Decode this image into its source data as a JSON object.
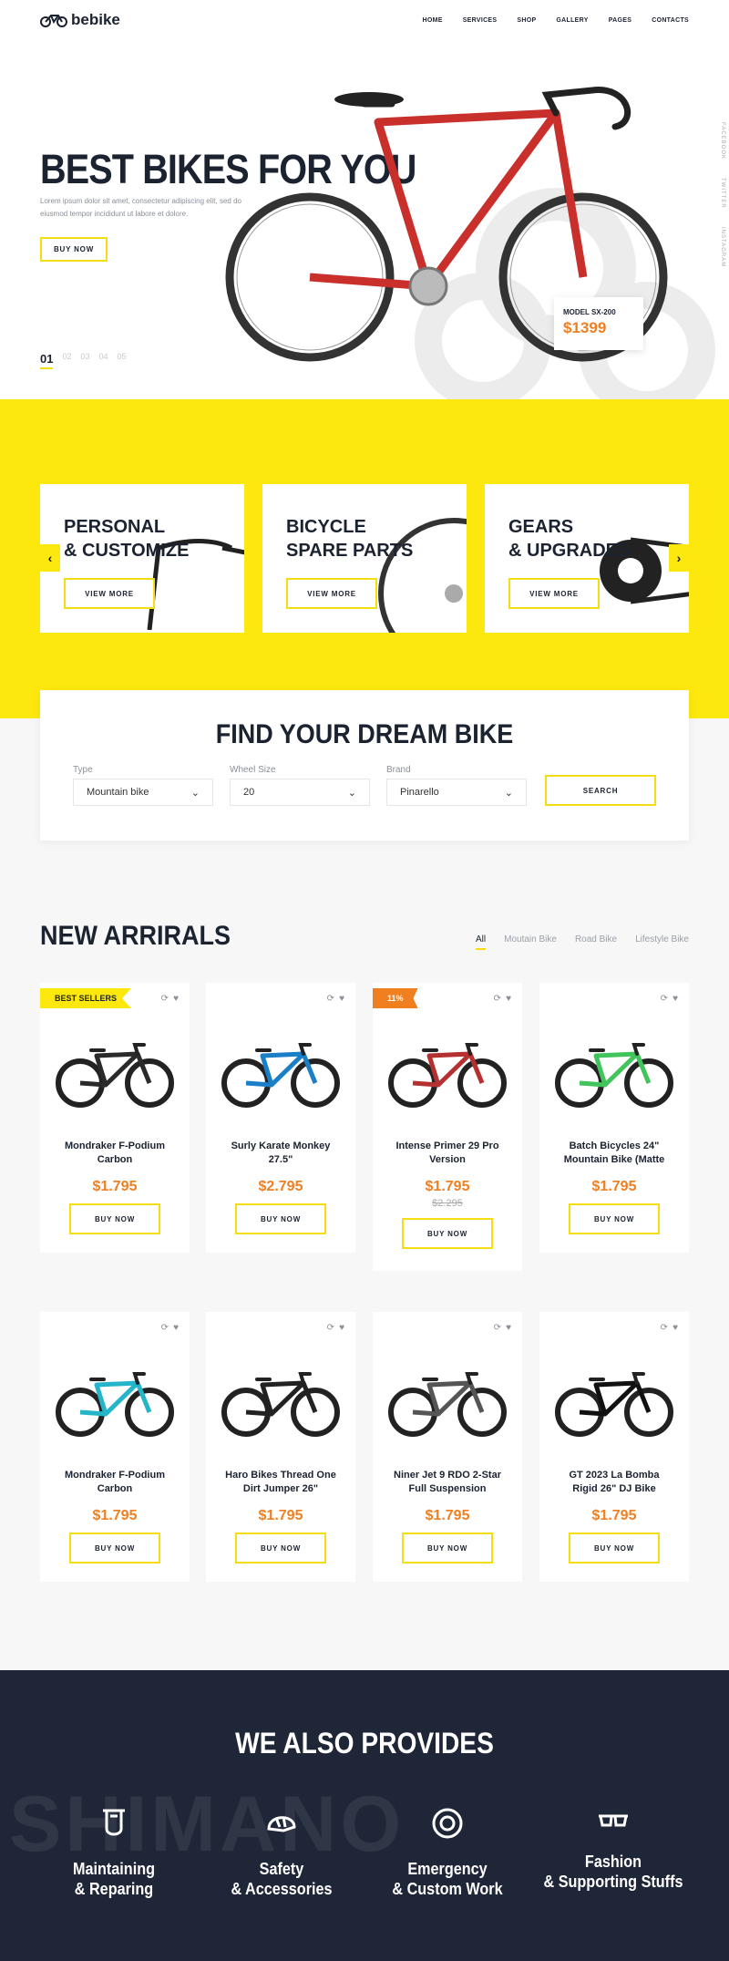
{
  "brand": {
    "name": "bebike"
  },
  "nav": [
    "HOME",
    "SERVICES",
    "SHOP",
    "GALLERY",
    "PAGES",
    "CONTACTS"
  ],
  "hero": {
    "title": "BEST BIKES FOR YOU",
    "desc": "Lorem ipsum dolor sit amet, consectetur adipiscing elit, sed do eiusmod tempor incididunt ut labore et dolore.",
    "button": "BUY NOW",
    "model": "MODEL SX-200",
    "price": "$1399",
    "slides": [
      "01",
      "02",
      "03",
      "04",
      "05"
    ],
    "social": [
      "FACEBOOK",
      "TWITTER",
      "INSTAGRAM"
    ]
  },
  "categories": [
    {
      "title_1": "PERSONAL",
      "title_2": "& CUSTOMIZE",
      "button": "VIEW MORE"
    },
    {
      "title_1": "BICYCLE",
      "title_2": "SPARE PARTS",
      "button": "VIEW MORE"
    },
    {
      "title_1": "GEARS",
      "title_2": "& UPGRADES",
      "button": "VIEW MORE"
    }
  ],
  "finder": {
    "title": "FIND YOUR DREAM BIKE",
    "type_label": "Type",
    "type_value": "Mountain bike",
    "wheel_label": "Wheel Size",
    "wheel_value": "20",
    "brand_label": "Brand",
    "brand_value": "Pinarello",
    "search": "SEARCH"
  },
  "arrivals": {
    "title": "NEW ARRIRALS",
    "tabs": [
      "All",
      "Moutain Bike",
      "Road Bike",
      "Lifestyle Bike"
    ]
  },
  "products": [
    {
      "badge": "BEST SELLERS",
      "name": "Mondraker F-Podium Carbon",
      "price": "$1.795",
      "old": "",
      "button": "BUY NOW",
      "color": "#2a2a2a"
    },
    {
      "badge": "",
      "name": "Surly Karate Monkey 27.5\"",
      "price": "$2.795",
      "old": "",
      "button": "BUY NOW",
      "color": "#1a7fc7"
    },
    {
      "badge": "11%",
      "name": "Intense Primer 29 Pro Version",
      "price": "$1.795",
      "old": "$2.295",
      "button": "BUY NOW",
      "color": "#b53030"
    },
    {
      "badge": "",
      "name": "Batch Bicycles 24\" Mountain Bike (Matte",
      "price": "$1.795",
      "old": "",
      "button": "BUY NOW",
      "color": "#42c45c"
    },
    {
      "badge": "",
      "name": "Mondraker F-Podium Carbon",
      "price": "$1.795",
      "old": "",
      "button": "BUY NOW",
      "color": "#25b5c9"
    },
    {
      "badge": "",
      "name": "Haro Bikes Thread One Dirt Jumper 26\"",
      "price": "$1.795",
      "old": "",
      "button": "BUY NOW",
      "color": "#222222"
    },
    {
      "badge": "",
      "name": "Niner Jet 9 RDO 2-Star Full Suspension",
      "price": "$1.795",
      "old": "",
      "button": "BUY NOW",
      "color": "#555555"
    },
    {
      "badge": "",
      "name": "GT 2023 La Bomba Rigid 26\" DJ Bike",
      "price": "$1.795",
      "old": "",
      "button": "BUY NOW",
      "color": "#111111"
    }
  ],
  "provides": {
    "title": "WE ALSO PROVIDES",
    "ghost": "SHIMANO",
    "items": [
      {
        "l1": "Maintaining",
        "l2": "& Reparing",
        "icon": "tools-icon"
      },
      {
        "l1": "Safety",
        "l2": "& Accessories",
        "icon": "helmet-icon"
      },
      {
        "l1": "Emergency",
        "l2": "& Custom Work",
        "icon": "wheel-icon"
      },
      {
        "l1": "Fashion",
        "l2": "& Supporting Stuffs",
        "icon": "glasses-icon"
      }
    ]
  }
}
